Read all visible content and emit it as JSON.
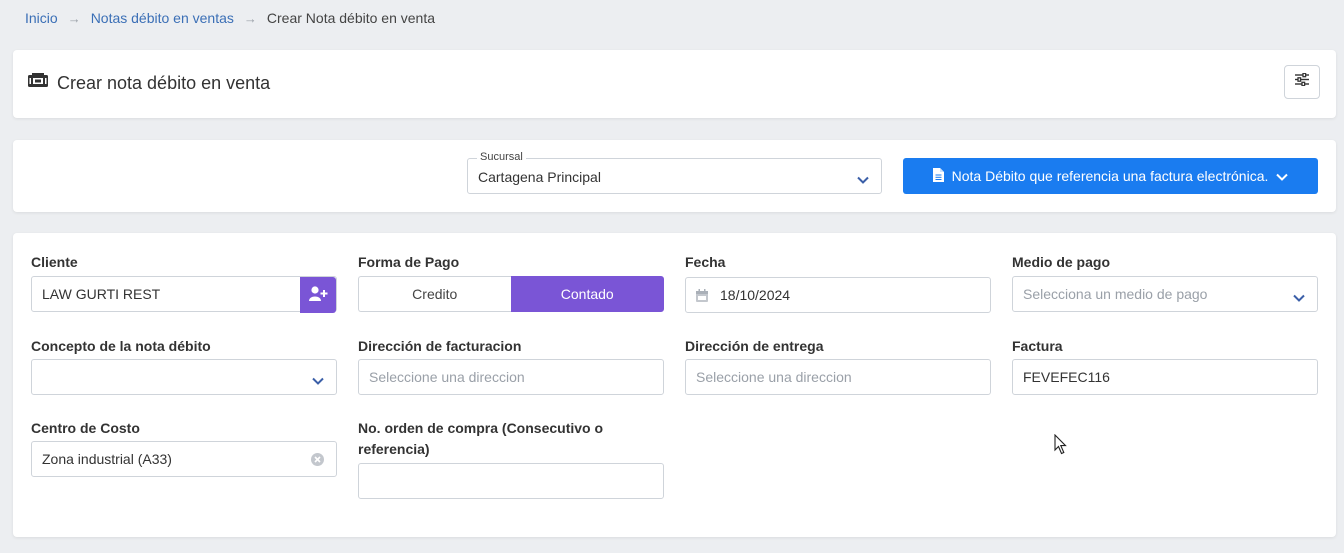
{
  "breadcrumb": {
    "home": "Inicio",
    "section": "Notas débito en ventas",
    "current": "Crear Nota débito en venta",
    "separator": "→"
  },
  "header": {
    "title": "Crear nota débito en venta",
    "title_icon": "cash-register-icon",
    "settings_icon": "sliders-icon"
  },
  "branch": {
    "legend": "Sucursal",
    "value": "Cartagena Principal"
  },
  "doc_type_button": {
    "label": "Nota Débito que referencia una factura electrónica.",
    "icon": "document-icon",
    "color": "#1a7cf0"
  },
  "form": {
    "cliente": {
      "label": "Cliente",
      "value": "LAW GURTI REST",
      "add_icon": "user-plus-icon"
    },
    "forma_pago": {
      "label": "Forma de Pago",
      "options": [
        "Credito",
        "Contado"
      ],
      "selected": "Contado"
    },
    "fecha": {
      "label": "Fecha",
      "value": "18/10/2024",
      "icon": "calendar-icon"
    },
    "medio_pago": {
      "label": "Medio de pago",
      "placeholder": "Selecciona un medio de pago"
    },
    "concepto": {
      "label": "Concepto de la nota débito",
      "value": ""
    },
    "direccion_facturacion": {
      "label": "Dirección de facturacion",
      "placeholder": "Seleccione una direccion"
    },
    "direccion_entrega": {
      "label": "Dirección de entrega",
      "placeholder": "Seleccione una direccion"
    },
    "factura": {
      "label": "Factura",
      "value": "FEVEFEC116"
    },
    "centro_costo": {
      "label": "Centro de Costo",
      "value": "Zona industrial (A33)",
      "clear_icon": "clear-circle-icon"
    },
    "orden_compra": {
      "label": "No. orden de compra (Consecutivo o referencia)",
      "value": ""
    }
  },
  "colors": {
    "accent": "#7a55d6",
    "link": "#3b6fb6",
    "primary": "#1a7cf0"
  }
}
